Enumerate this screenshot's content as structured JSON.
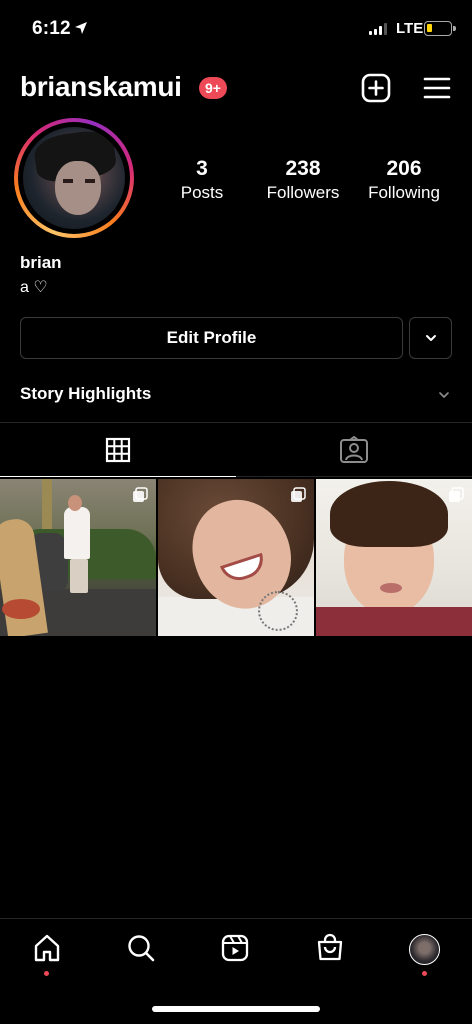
{
  "status_bar": {
    "time": "6:12",
    "network": "LTE",
    "battery_color": "#ffd60a"
  },
  "header": {
    "username": "brianskamui",
    "notification_badge": "9+",
    "add_icon": "add-square-icon",
    "menu_icon": "hamburger-menu-icon"
  },
  "profile": {
    "stats": [
      {
        "value": "3",
        "label": "Posts"
      },
      {
        "value": "238",
        "label": "Followers"
      },
      {
        "value": "206",
        "label": "Following"
      }
    ],
    "name": "brian",
    "bio": "a ♡",
    "edit_button": "Edit Profile",
    "story_highlights": "Story Highlights"
  },
  "tabs": [
    {
      "icon": "grid-icon",
      "active": true
    },
    {
      "icon": "tagged-user-icon",
      "active": false
    }
  ],
  "posts": [
    {
      "kind": "photo",
      "multi": true
    },
    {
      "kind": "photo",
      "multi": true
    },
    {
      "kind": "photo",
      "multi": true
    }
  ],
  "bottom_nav": {
    "items": [
      "home-icon",
      "search-icon",
      "reels-icon",
      "shop-icon",
      "profile-avatar"
    ],
    "accent": "#ed4956"
  }
}
